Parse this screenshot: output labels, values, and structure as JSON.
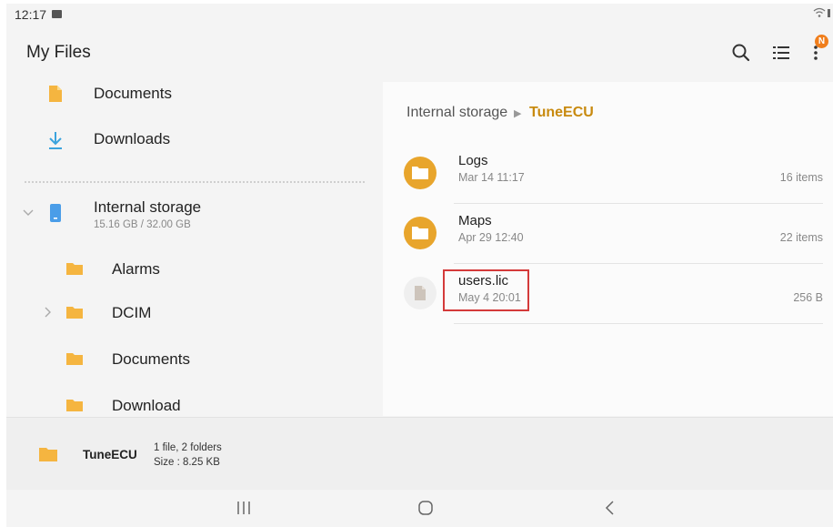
{
  "status": {
    "time": "12:17"
  },
  "app": {
    "title": "My Files",
    "notification_badge": "N"
  },
  "sidebar": {
    "documents": "Documents",
    "downloads": "Downloads",
    "storage": {
      "label": "Internal storage",
      "usage": "15.16 GB / 32.00 GB"
    },
    "folders": [
      "Alarms",
      "DCIM",
      "Documents",
      "Download"
    ]
  },
  "breadcrumb": {
    "root": "Internal storage",
    "separator": "▶",
    "current": "TuneECU"
  },
  "files": [
    {
      "name": "Logs",
      "date": "Mar 14 11:17",
      "meta": "16 items",
      "type": "folder"
    },
    {
      "name": "Maps",
      "date": "Apr 29 12:40",
      "meta": "22 items",
      "type": "folder"
    },
    {
      "name": "users.lic",
      "date": "May 4 20:01",
      "meta": "256 B",
      "type": "file"
    }
  ],
  "selection_info": {
    "name": "TuneECU",
    "count": "1 file, 2 folders",
    "size": "Size : 8.25 KB"
  },
  "colors": {
    "folder": "#f5b540",
    "folder_list": "#e8a52c",
    "accent": "#c88a0f",
    "badge": "#f07e1c",
    "highlight": "#d43a3a"
  }
}
